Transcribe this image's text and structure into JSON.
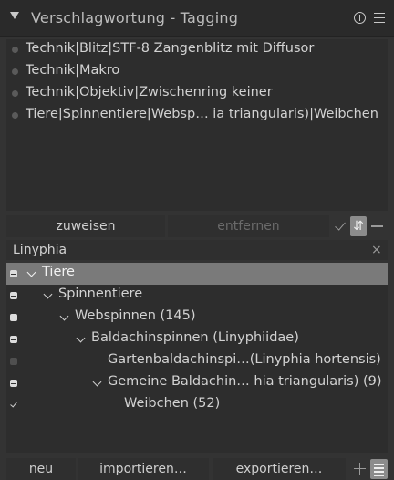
{
  "header": {
    "title": "Verschlagwortung - Tagging",
    "icons": [
      "collapse-arrow-icon",
      "info-icon",
      "menu-icon"
    ]
  },
  "attached_tags": [
    "Technik|Blitz|STF-8 Zangenblitz mit Diffusor",
    "Technik|Makro",
    "Technik|Objektiv|Zwischenring keiner",
    "Tiere|Spinnentiere|Websp… ia triangularis)|Weibchen"
  ],
  "toolbar": {
    "attach_label": "zuweisen",
    "detach_label": "entfernen",
    "icons": [
      "check-icon",
      "sort-icon",
      "minus-icon"
    ]
  },
  "search": {
    "value": "Linyphia",
    "clear_glyph": "×"
  },
  "tree": [
    {
      "label": "Tiere",
      "state": "partial",
      "depth": 0,
      "expanded": true,
      "selected": true
    },
    {
      "label": "Spinnentiere",
      "state": "partial",
      "depth": 1,
      "expanded": true
    },
    {
      "label": "Webspinnen (145)",
      "state": "partial",
      "depth": 2,
      "expanded": true
    },
    {
      "label": "Baldachinspinnen (Linyphiidae)",
      "state": "partial",
      "depth": 3,
      "expanded": true
    },
    {
      "label": "Gartenbaldachinspi…(Linyphia hortensis)",
      "state": "none",
      "depth": 4,
      "expanded": null
    },
    {
      "label": "Gemeine Baldachin… hia triangularis) (9)",
      "state": "partial",
      "depth": 4,
      "expanded": true
    },
    {
      "label": "Weibchen (52)",
      "state": "checked",
      "depth": 5,
      "expanded": null
    }
  ],
  "bottom": {
    "new_label": "neu",
    "import_label": "importieren…",
    "export_label": "exportieren…",
    "icons": [
      "plus-icon",
      "list-view-icon"
    ]
  }
}
